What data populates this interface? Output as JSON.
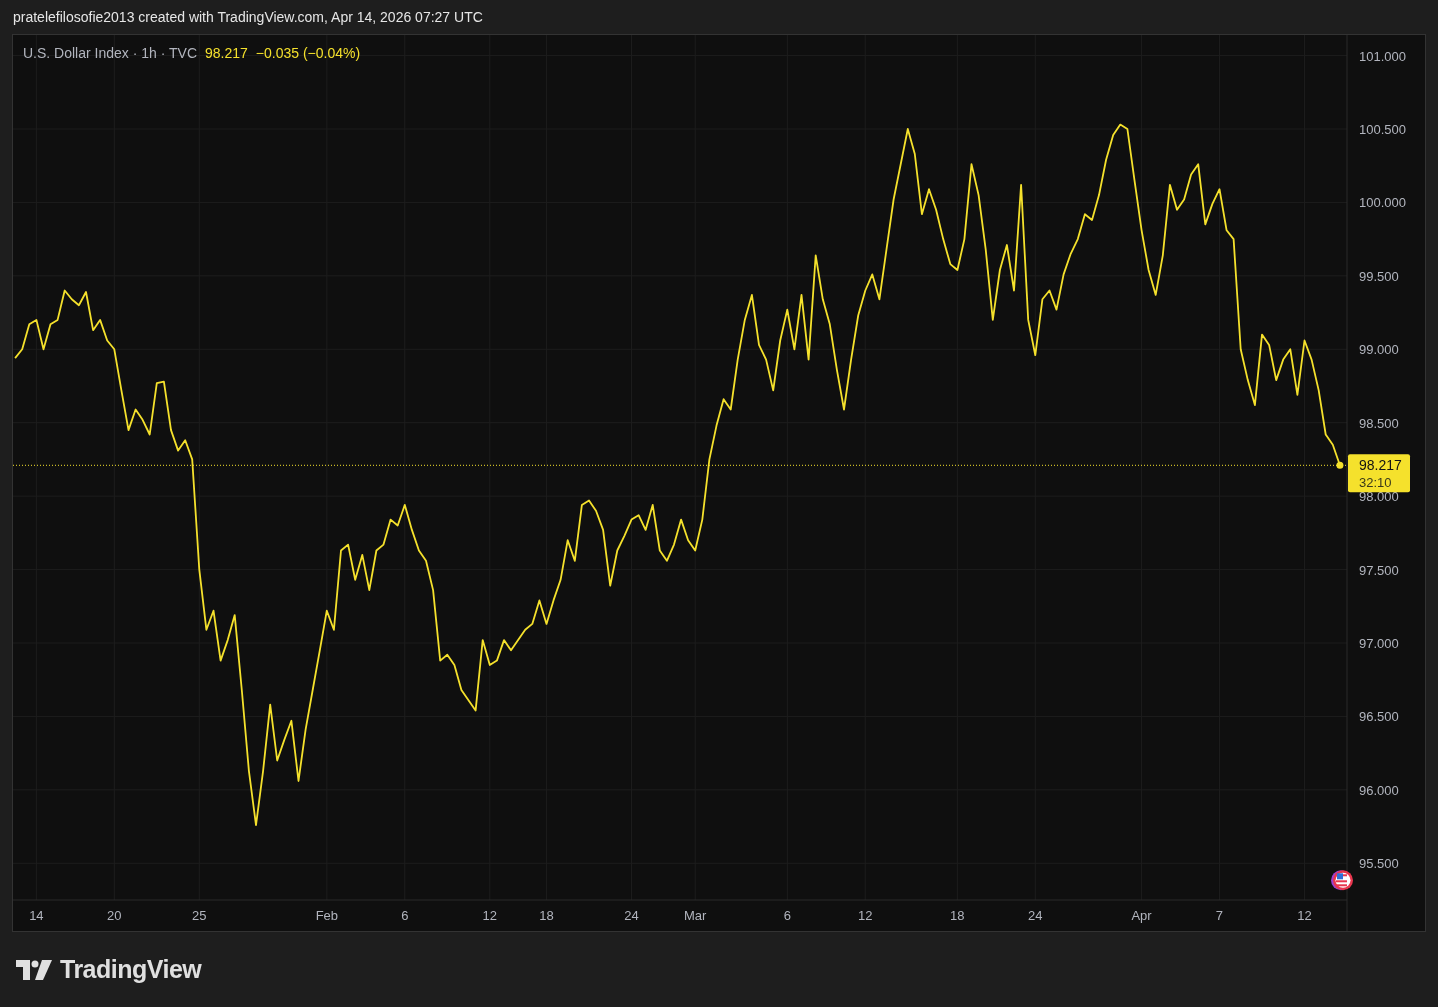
{
  "header": {
    "caption": "pratelefilosofie2013 created with TradingView.com, Apr 14, 2026 07:27 UTC"
  },
  "legend": {
    "symbol": "U.S. Dollar Index · 1h · TVC",
    "price": "98.217",
    "change": "−0.035 (−0.04%)"
  },
  "last_price": {
    "price": "98.217",
    "countdown": "32:10"
  },
  "chart_data": {
    "type": "line",
    "grid": true,
    "ref_lines": [
      {
        "axis": "y",
        "value": 98.21
      }
    ],
    "ylim": [
      95.25,
      101.14
    ],
    "yticks": [
      {
        "value": 101,
        "label": "101.000"
      },
      {
        "value": 100.5,
        "label": "100.500"
      },
      {
        "value": 100,
        "label": "100.000"
      },
      {
        "value": 99.5,
        "label": "99.500"
      },
      {
        "value": 99,
        "label": "99.000"
      },
      {
        "value": 98.5,
        "label": "98.500"
      },
      {
        "value": 98,
        "label": "98.000"
      },
      {
        "value": 97.5,
        "label": "97.500"
      },
      {
        "value": 97,
        "label": "97.000"
      },
      {
        "value": 96.5,
        "label": "96.500"
      },
      {
        "value": 96,
        "label": "96.000"
      },
      {
        "value": 95.5,
        "label": "95.500"
      }
    ],
    "categories": [
      null,
      null,
      null,
      "14",
      null,
      null,
      null,
      null,
      null,
      null,
      null,
      null,
      null,
      null,
      "20",
      null,
      null,
      null,
      null,
      null,
      null,
      null,
      null,
      null,
      null,
      null,
      "25",
      null,
      null,
      null,
      null,
      null,
      null,
      null,
      null,
      null,
      null,
      null,
      null,
      null,
      null,
      null,
      null,
      null,
      "Feb",
      null,
      null,
      null,
      null,
      null,
      null,
      null,
      null,
      null,
      null,
      "6",
      null,
      null,
      null,
      null,
      null,
      null,
      null,
      null,
      null,
      null,
      null,
      "12",
      null,
      null,
      null,
      null,
      null,
      null,
      null,
      "18",
      null,
      null,
      null,
      null,
      null,
      null,
      null,
      null,
      null,
      null,
      null,
      "24",
      null,
      null,
      null,
      null,
      null,
      null,
      null,
      null,
      "Mar",
      null,
      null,
      null,
      null,
      null,
      null,
      null,
      null,
      null,
      null,
      null,
      null,
      "6",
      null,
      null,
      null,
      null,
      null,
      null,
      null,
      null,
      null,
      null,
      "12",
      null,
      null,
      null,
      null,
      null,
      null,
      null,
      null,
      null,
      null,
      null,
      null,
      "18",
      null,
      null,
      null,
      null,
      null,
      null,
      null,
      null,
      null,
      null,
      "24",
      null,
      null,
      null,
      null,
      null,
      null,
      null,
      null,
      null,
      null,
      null,
      null,
      null,
      null,
      "Apr",
      null,
      null,
      null,
      null,
      null,
      null,
      null,
      null,
      null,
      null,
      "7",
      null,
      null,
      null,
      null,
      null,
      null,
      null,
      null,
      null,
      null,
      null,
      "12",
      null,
      null,
      null,
      null,
      null
    ],
    "series": [
      {
        "color": "#f5e12c",
        "values": [
          98.94,
          99.0,
          99.17,
          99.2,
          99.0,
          99.17,
          99.2,
          99.4,
          99.34,
          99.3,
          99.39,
          99.13,
          99.2,
          99.06,
          99.0,
          98.72,
          98.45,
          98.59,
          98.52,
          98.42,
          98.77,
          98.78,
          98.45,
          98.31,
          98.38,
          98.25,
          97.5,
          97.09,
          97.22,
          96.88,
          97.02,
          97.19,
          96.68,
          96.13,
          95.76,
          96.13,
          96.58,
          96.2,
          96.34,
          96.47,
          96.06,
          96.41,
          96.68,
          96.95,
          97.22,
          97.09,
          97.63,
          97.67,
          97.43,
          97.6,
          97.36,
          97.63,
          97.67,
          97.84,
          97.8,
          97.94,
          97.77,
          97.63,
          97.56,
          97.36,
          96.88,
          96.92,
          96.85,
          96.68,
          96.61,
          96.54,
          97.02,
          96.85,
          96.88,
          97.02,
          96.95,
          97.02,
          97.09,
          97.13,
          97.29,
          97.13,
          97.29,
          97.43,
          97.7,
          97.56,
          97.94,
          97.97,
          97.9,
          97.77,
          97.39,
          97.63,
          97.73,
          97.84,
          97.87,
          97.77,
          97.94,
          97.63,
          97.56,
          97.67,
          97.84,
          97.7,
          97.63,
          97.84,
          98.25,
          98.48,
          98.66,
          98.59,
          98.93,
          99.2,
          99.37,
          99.03,
          98.93,
          98.72,
          99.06,
          99.27,
          99.0,
          99.37,
          98.93,
          99.64,
          99.34,
          99.17,
          98.86,
          98.59,
          98.93,
          99.23,
          99.4,
          99.51,
          99.34,
          99.68,
          100.02,
          100.26,
          100.5,
          100.33,
          99.92,
          100.09,
          99.95,
          99.75,
          99.58,
          99.54,
          99.75,
          100.26,
          100.05,
          99.68,
          99.2,
          99.54,
          99.71,
          99.4,
          100.12,
          99.2,
          98.96,
          99.34,
          99.4,
          99.27,
          99.51,
          99.65,
          99.75,
          99.92,
          99.88,
          100.05,
          100.29,
          100.46,
          100.53,
          100.5,
          100.15,
          99.81,
          99.54,
          99.37,
          99.64,
          100.12,
          99.95,
          100.02,
          100.19,
          100.26,
          99.85,
          99.99,
          100.09,
          99.81,
          99.75,
          99.0,
          98.79,
          98.62,
          99.1,
          99.03,
          98.79,
          98.93,
          99.0,
          98.69,
          99.06,
          98.93,
          98.72,
          98.42,
          98.35,
          98.21
        ]
      }
    ]
  },
  "footer": {
    "brand": "TradingView"
  }
}
